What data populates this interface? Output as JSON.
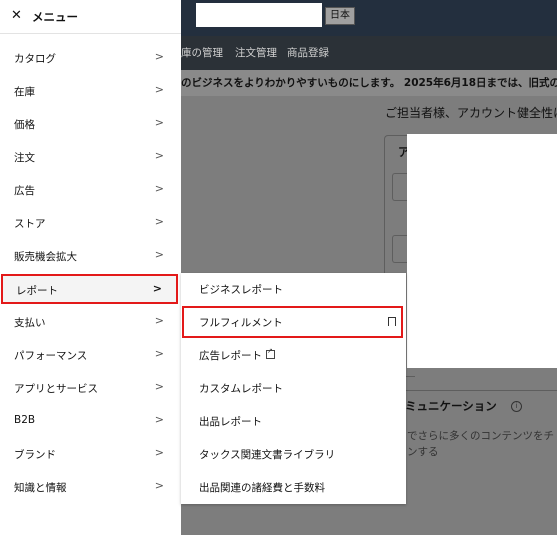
{
  "menu": {
    "title": "メニュー",
    "items": [
      {
        "label": "カタログ"
      },
      {
        "label": "在庫"
      },
      {
        "label": "価格"
      },
      {
        "label": "注文"
      },
      {
        "label": "広告"
      },
      {
        "label": "ストア"
      },
      {
        "label": "販売機会拡大"
      },
      {
        "label": "レポート"
      },
      {
        "label": "支払い"
      },
      {
        "label": "パフォーマンス"
      },
      {
        "label": "アプリとサービス"
      },
      {
        "label": "B2B"
      },
      {
        "label": "ブランド"
      },
      {
        "label": "知識と情報"
      }
    ]
  },
  "submenu": {
    "items": [
      {
        "label": "ビジネスレポート"
      },
      {
        "label": "フルフィルメント"
      },
      {
        "label": "広告レポート"
      },
      {
        "label": "カスタムレポート"
      },
      {
        "label": "出品レポート"
      },
      {
        "label": "タックス関連文書ライブラリ"
      },
      {
        "label": "出品関連の諸経費と手数料"
      }
    ]
  },
  "background": {
    "language": "日本",
    "nav_links": [
      "庫の管理",
      "注文管理",
      "商品登録"
    ],
    "banner": "のビジネスをよりわかりやすいものにします。 2025年6月18日までは、旧式のエ",
    "greeting": "ご担当者様、アカウント健全性に",
    "card_letter": "ア",
    "section_title": "ミュニケーション",
    "section_line1": "でさらに多くのコンテンツをチ",
    "section_line2": "ンする"
  }
}
